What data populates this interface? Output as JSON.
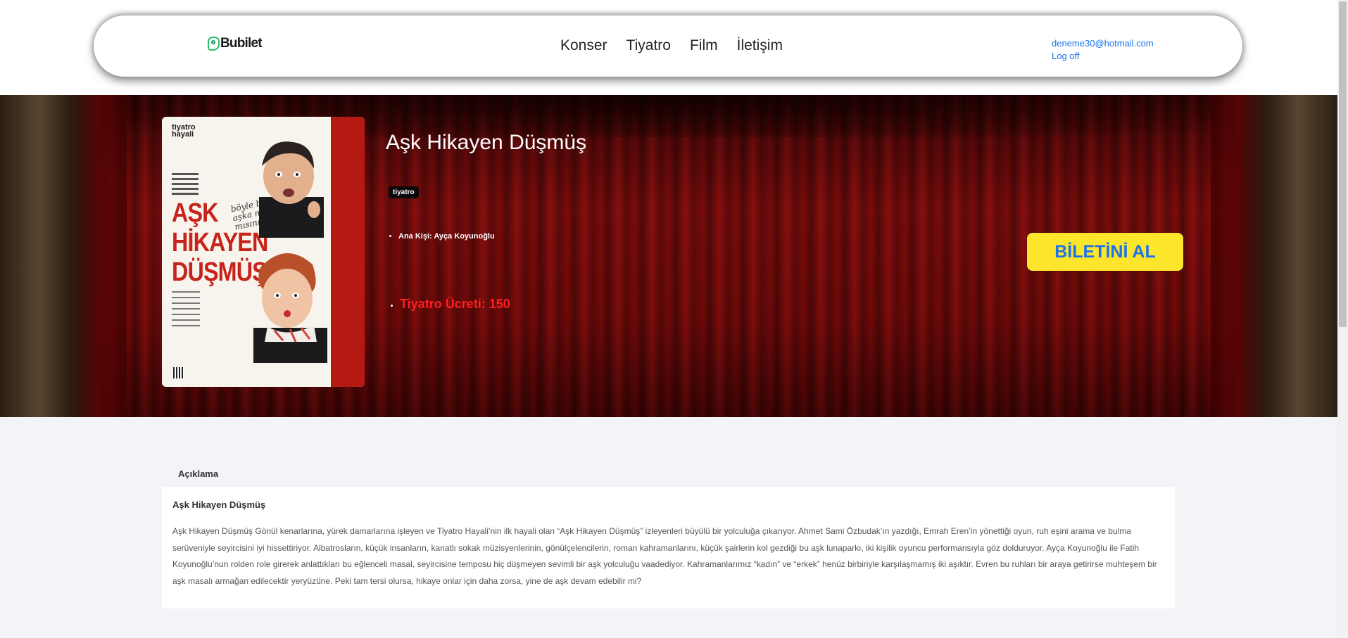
{
  "header": {
    "logo_text": "Bubilet",
    "nav": [
      "Konser",
      "Tiyatro",
      "Film",
      "İletişim"
    ],
    "user_email": "deneme30@hotmail.com",
    "logoff_label": "Log off"
  },
  "event": {
    "title": "Aşk Hikayen Düşmüş",
    "category": "tiyatro",
    "cast": "Ana Kişi: Ayça Koyunoğlu",
    "price": "Tiyatro Ücreti: 150",
    "buy_label": "BİLETİNİ AL",
    "poster": {
      "logo_line1": "tiyatro",
      "logo_line2": "hayali",
      "title_line1": "AŞK",
      "title_line2": "HİKAYEN",
      "title_line3": "DÜŞMÜŞ",
      "tagline": "böyle bir aşka nanır mısınız?"
    }
  },
  "description": {
    "tab_label": "Açıklama",
    "heading": "Aşk Hikayen Düşmüş",
    "body": "Aşk Hikayen Düşmüş Gönül kenarlarına, yürek damarlarına işleyen ve Tiyatro Hayali’nin ilk hayali olan “Aşk Hikayen Düşmüş” izleyenleri büyülü bir yolculuğa çıkarıyor. Ahmet Sami Özbudak’ın yazdığı, Emrah Eren’in yönettiği oyun, ruh eşini arama ve bulma serüveniyle seyircisini iyi hissettiriyor. Albatrosların, küçük insanların, kanatlı sokak müzisyenlerinin, gönülçelencilerin, roman kahramanlarını, küçük şairlerin kol gezdiği bu aşk lunaparkı, iki kişilik oyuncu performansıyla göz dolduruyor. Ayça Koyunoğlu ile Fatih Koyunoğlu’nun rolden role girerek anlattıkları bu eğlenceli masal, seyircisine temposu hiç düşmeyen sevimli bir aşk yolculuğu vaadediyor. Kahramanlarımız “kadın” ve “erkek” henüz birbiriyle karşılaşmamış iki aşıktır. Evren bu ruhları bir araya getirirse muhteşem bir aşk masalı armağan edilecektir yeryüzüne. Peki tam tersi olursa, hikaye onlar için daha zorsa, yine de aşk devam edebilir mi?"
  },
  "colors": {
    "accent_link": "#1a73e8",
    "button_bg": "#fde52b",
    "price_red": "#ff1e1e",
    "logo_green": "#27c26b"
  }
}
